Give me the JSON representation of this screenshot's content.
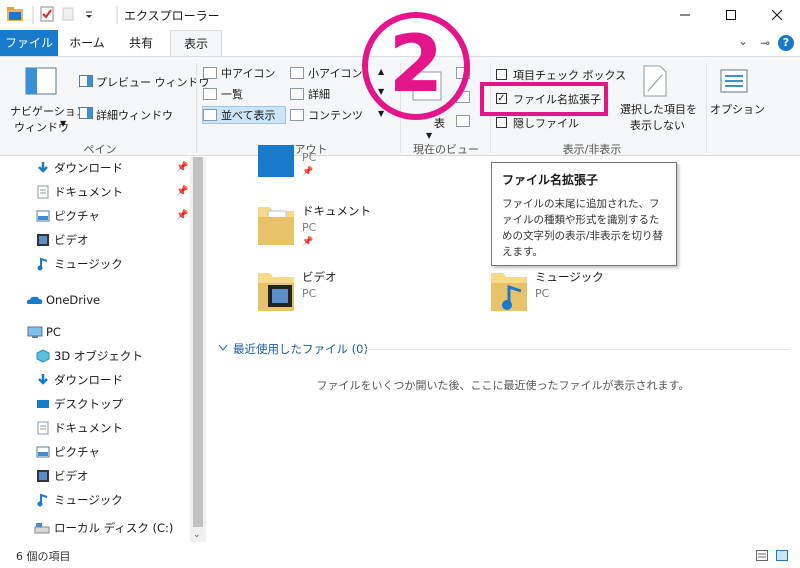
{
  "window": {
    "title": "エクスプローラー"
  },
  "tabs": {
    "file": "ファイル",
    "home": "ホーム",
    "share": "共有",
    "view": "表示"
  },
  "ribbon": {
    "pane": {
      "nav_pane_line1": "ナビゲーション",
      "nav_pane_line2": "ウィンドウ",
      "preview": "プレビュー ウィンドウ",
      "details": "詳細ウィンドウ",
      "label": "ペイン"
    },
    "layout": {
      "medium_icons": "中アイコン",
      "small_icons": "小アイコン",
      "list": "一覧",
      "details": "詳細",
      "tiles": "並べて表示",
      "content": "コンテンツ",
      "label": "レイアウト"
    },
    "current_view": {
      "sort": "表",
      "label": "現在のビュー"
    },
    "show_hide": {
      "item_checkboxes": "項目チェック ボックス",
      "file_extensions": "ファイル名拡張子",
      "hidden_items": "隠しファイル",
      "hide_selected_line1": "選択した項目を",
      "hide_selected_line2": "表示しない",
      "label": "表示/非表示",
      "file_extensions_checked": true
    },
    "options": {
      "label": "オプション"
    }
  },
  "annotation": {
    "step": "2"
  },
  "tooltip": {
    "title": "ファイル名拡張子",
    "body": "ファイルの末尾に追加された、ファイルの種類や形式を識別するための文字列の表示/非表示を切り替えます。"
  },
  "nav": {
    "quick_downloads": "ダウンロード",
    "quick_documents": "ドキュメント",
    "quick_pictures": "ピクチャ",
    "quick_videos": "ビデオ",
    "quick_music": "ミュージック",
    "onedrive": "OneDrive",
    "pc": "PC",
    "pc_3d": "3D オブジェクト",
    "pc_downloads": "ダウンロード",
    "pc_desktop": "デスクトップ",
    "pc_documents": "ドキュメント",
    "pc_pictures": "ピクチャ",
    "pc_videos": "ビデオ",
    "pc_music": "ミュージック",
    "pc_local_disk": "ローカル ディスク (C:)"
  },
  "content": {
    "tiles": [
      {
        "name": "",
        "sub": "PC"
      },
      {
        "name": "ドキュメント",
        "sub": "PC"
      },
      {
        "name": "ビデオ",
        "sub": "PC"
      },
      {
        "name": "ミュージック",
        "sub": "PC"
      }
    ],
    "recent_header": "最近使用したファイル (0)",
    "recent_empty": "ファイルをいくつか開いた後、ここに最近使ったファイルが表示されます。"
  },
  "status": {
    "item_count": "6 個の項目"
  },
  "colors": {
    "accent": "#1979ca",
    "annotation": "#e4148a",
    "ribbon_bg": "#f5f6f7",
    "link": "#1e5aa8"
  }
}
